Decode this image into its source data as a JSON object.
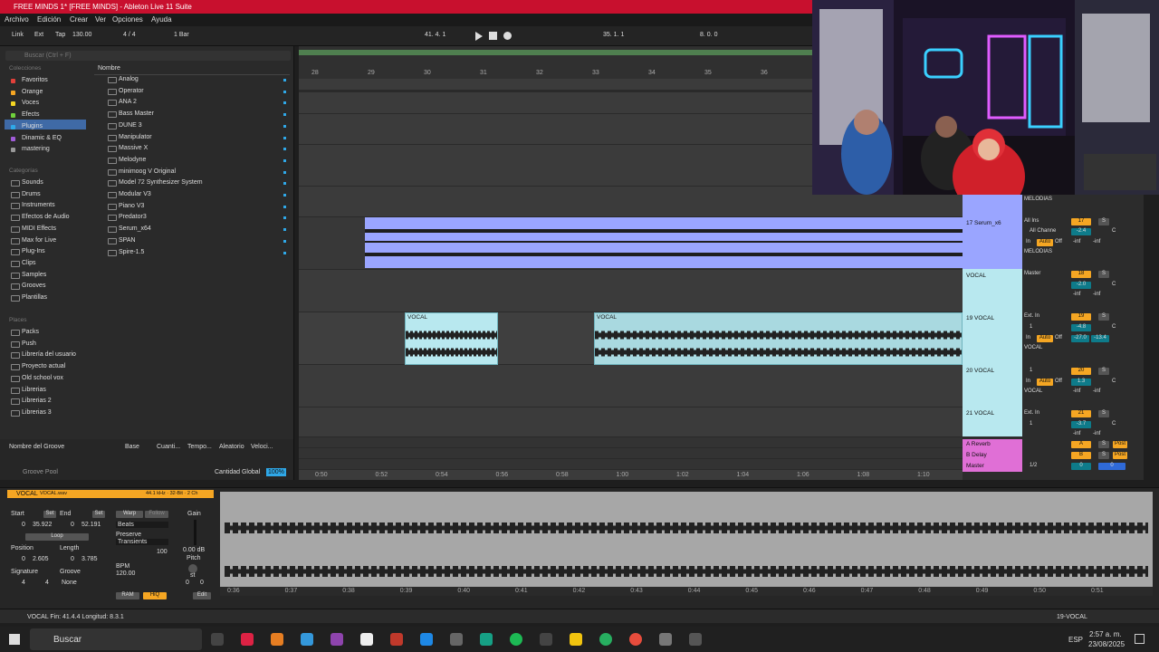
{
  "title": "FREE MINDS 1*  [FREE MINDS] - Ableton Live 11 Suite",
  "menu": [
    "Archivo",
    "Edición",
    "Crear",
    "Ver",
    "Opciones",
    "Ayuda"
  ],
  "control": {
    "link": "Link",
    "ext": "Ext",
    "tap": "Tap",
    "tempo": "130.00",
    "sig": "4 / 4",
    "quant": "1 Bar",
    "pos1": "41.  4.  1",
    "pos2": "35.  1.  1",
    "pos3": "8.  0.  0"
  },
  "browser": {
    "search": "Buscar (Ctrl + F)",
    "collections_title": "Colecciones",
    "collections": [
      {
        "label": "Favoritos",
        "color": "#e2403a"
      },
      {
        "label": "Orange",
        "color": "#f5a623"
      },
      {
        "label": "Voces",
        "color": "#f5d623"
      },
      {
        "label": "Efects",
        "color": "#6fd13c"
      },
      {
        "label": "Plugins",
        "color": "#2fa8e8"
      },
      {
        "label": "Dinamic & EQ",
        "color": "#a05cd8"
      },
      {
        "label": "mastering",
        "color": "#999999"
      }
    ],
    "categories_title": "Categorías",
    "categories": [
      "Sounds",
      "Drums",
      "Instruments",
      "Efectos de Audio",
      "MIDI Effects",
      "Max for Live",
      "Plug-Ins",
      "Clips",
      "Samples",
      "Grooves",
      "Plantillas"
    ],
    "places_title": "Places",
    "places": [
      "Packs",
      "Push",
      "Librería del usuario",
      "Proyecto actual",
      "Old school vox",
      "Librerias",
      "Librerias 2",
      "Librerias 3"
    ],
    "column_name": "Nombre",
    "items": [
      "Analog",
      "Operator",
      "ANA 2",
      "Bass Master",
      "DUNE 3",
      "Manipulator",
      "Massive X",
      "Melodyne",
      "minimoog V Original",
      "Model 72 Synthesizer System",
      "Modular V3",
      "Piano V3",
      "Predator3",
      "Serum_x64",
      "SPAN",
      "Spire-1.5"
    ]
  },
  "groove": {
    "cols": [
      "Nombre del Groove",
      "Base",
      "Cuanti...",
      "Tempo...",
      "Aleatorio",
      "Veloci..."
    ],
    "pool": "Groove Pool",
    "global": "Cantidad Global",
    "global_val": "100%"
  },
  "ruler": [
    "28",
    "29",
    "30",
    "31",
    "32",
    "33",
    "34",
    "35",
    "36"
  ],
  "time_ruler": [
    "0:50",
    "0:52",
    "0:54",
    "0:56",
    "0:58",
    "1:00",
    "1:02",
    "1:04",
    "1:06",
    "1:08",
    "1:10"
  ],
  "clips": {
    "vocal_a": "VOCAL",
    "vocal_b": "VOCAL"
  },
  "tracks": [
    {
      "name": "MELODIAS",
      "route": "",
      "num": ""
    },
    {
      "name": "17 Serum_x6",
      "in": "All Ins",
      "ch": "All Channe",
      "out": "MELODIAS",
      "num": "17",
      "vol": "-2.4",
      "pan": "C",
      "l": "-inf",
      "r": "-inf",
      "color": "#9aa5ff"
    },
    {
      "name": "VOCAL",
      "in": "Master",
      "num": "18",
      "vol": "-2.0",
      "pan": "C",
      "l": "-inf",
      "r": "-inf",
      "color": "#b8e8ef"
    },
    {
      "name": "19 VOCAL",
      "in": "Ext. In",
      "ch": "1",
      "out": "VOCAL",
      "num": "19",
      "vol": "-4.8",
      "pan": "C",
      "l": "-27.0",
      "r": "-13.4",
      "color": "#b8e8ef"
    },
    {
      "name": "20 VOCAL",
      "in": "1",
      "out": "VOCAL",
      "num": "20",
      "vol": "1.3",
      "pan": "C",
      "l": "-inf",
      "r": "-inf",
      "color": "#b8e8ef"
    },
    {
      "name": "21 VOCAL",
      "in": "Ext. In",
      "ch": "1",
      "num": "21",
      "vol": "-3.7",
      "pan": "C",
      "l": "-inf",
      "r": "-inf",
      "color": "#b8e8ef"
    }
  ],
  "returns": [
    {
      "name": "A Reverb",
      "num": "A",
      "post": "Post",
      "color": "#e06fd6"
    },
    {
      "name": "B Delay",
      "num": "B",
      "post": "Post",
      "color": "#e06fd6"
    },
    {
      "name": "Master",
      "sel": "1/2",
      "num": "0",
      "val": "0",
      "color": "#e06fd6"
    }
  ],
  "mixer_labels": {
    "s": "S",
    "in": "In",
    "auto": "Auto",
    "off": "Off"
  },
  "clipview": {
    "name": "VOCAL",
    "file": "VOCAL.wav",
    "info": "44.1 kHz · 32-Bit · 2 Ch",
    "start": "Start",
    "end": "End",
    "set": "Set",
    "start_val": [
      "0",
      "35.922"
    ],
    "end_val": [
      "0",
      "52.191"
    ],
    "loop": "Loop",
    "position": "Position",
    "length": "Length",
    "pos_val": [
      "0",
      "2.605"
    ],
    "len_val": [
      "0",
      "3.785"
    ],
    "signature": "Signature",
    "groove": "Groove",
    "sig_a": "4",
    "sig_b": "4",
    "groove_val": "None",
    "warp": "Warp",
    "follow": "Follow",
    "beats": "Beats",
    "preserve": "Preserve",
    "transients": "Transients",
    "pct": "100",
    "bpm": "BPM",
    "bpm_val": "120.00",
    "gain": "Gain",
    "gain_val": "0.00 dB",
    "pitch": "Pitch",
    "st": "st",
    "pitch_a": "0",
    "pitch_b": "0",
    "ram": "RAM",
    "hiq": "HiQ",
    "edit": "Edit"
  },
  "wave_ruler": [
    "0:36",
    "0:37",
    "0:38",
    "0:39",
    "0:40",
    "0:41",
    "0:42",
    "0:43",
    "0:44",
    "0:45",
    "0:46",
    "0:47",
    "0:48",
    "0:49",
    "0:50",
    "0:51"
  ],
  "status": {
    "msg": "VOCAL  Fin: 41.4.4  Longitud: 8.3.1",
    "track": "19-VOCAL"
  },
  "taskbar": {
    "search": "Buscar",
    "lang": "ESP",
    "time": "2:57 a. m.",
    "date": "23/08/2025"
  }
}
